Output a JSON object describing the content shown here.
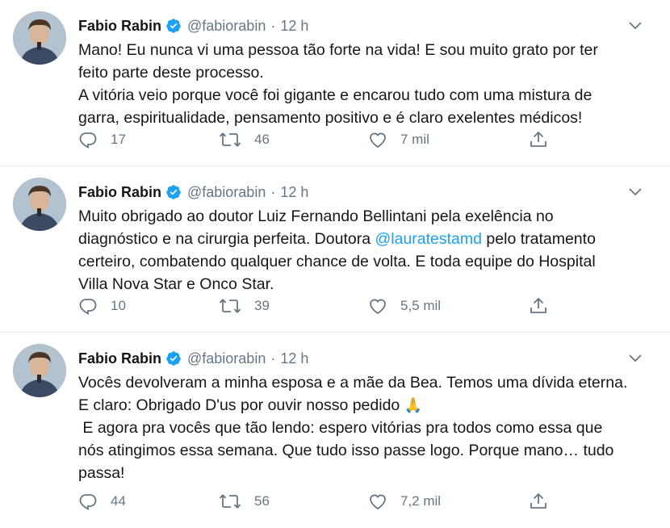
{
  "tweets": [
    {
      "author": "Fabio Rabin",
      "handle": "@fabiorabin",
      "separator": "·",
      "time": "12 h",
      "lines": [
        "Mano! Eu nunca vi uma pessoa tão forte na vida! E sou muito grato por ter",
        "feito parte deste processo.",
        "A vitória veio porque você foi gigante e encarou tudo com uma mistura de",
        "garra, espiritualidade, pensamento positivo e é claro exelentes médicos!"
      ],
      "replies": "17",
      "retweets": "46",
      "likes": "7 mil"
    },
    {
      "author": "Fabio Rabin",
      "handle": "@fabiorabin",
      "separator": "·",
      "time": "12 h",
      "lines": [
        "Muito obrigado ao doutor Luiz Fernando Bellintani pela exelência no",
        "diagnóstico e na cirurgia perfeita. Doutora ",
        "certeiro, combatendo qualquer chance de volta. E toda equipe do Hospital",
        "Villa Nova Star e Onco Star."
      ],
      "mention": "@laurates​tamd",
      "line2_after": " pelo tratamento",
      "replies": "10",
      "retweets": "39",
      "likes": "5,5 mil"
    },
    {
      "author": "Fabio Rabin",
      "handle": "@fabiorabin",
      "separator": "·",
      "time": "12 h",
      "lines": [
        "Vocês devolveram a minha esposa e a mãe da Bea. Temos uma dívida eterna.",
        "E claro: Obrigado D'us por ouvir nosso pedido ",
        " E agora pra vocês que tão lendo: espero vitórias pra todos como essa que",
        "nós atingimos essa semana. Que tudo isso passe logo. Porque mano… tudo",
        "passa!"
      ],
      "emoji": "🙏",
      "replies": "44",
      "retweets": "56",
      "likes": "7,2 mil"
    }
  ],
  "icons": {
    "verified": "verified-badge-icon",
    "caret": "chevron-down-icon",
    "reply": "reply-icon",
    "retweet": "retweet-icon",
    "like": "heart-icon",
    "share": "share-icon"
  },
  "colors": {
    "link": "#1da1f2",
    "muted": "#657786",
    "text": "#14171a",
    "divider": "#e6ecf0"
  }
}
